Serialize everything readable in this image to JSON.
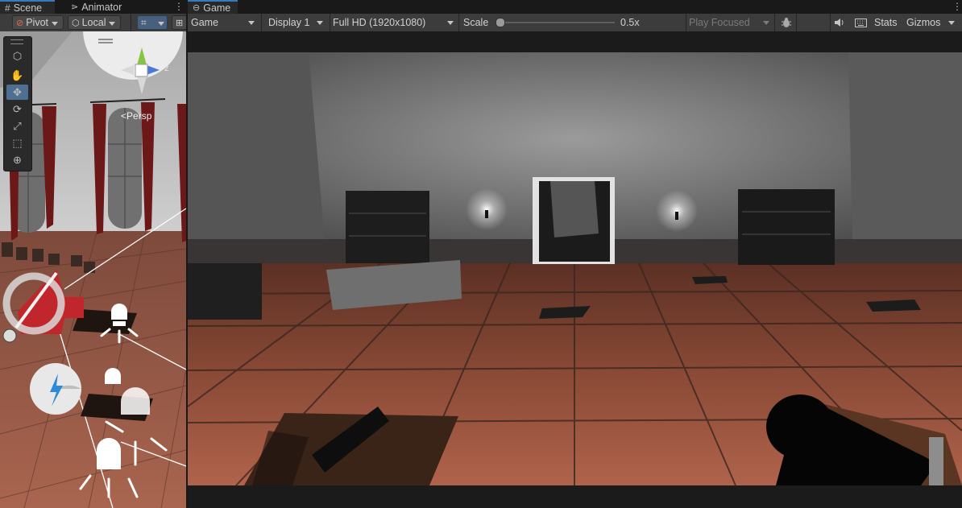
{
  "scene_panel": {
    "tabs": [
      {
        "label": "Scene",
        "icon": "hash-icon"
      },
      {
        "label": "Animator",
        "icon": "animator-icon"
      }
    ],
    "toolbar": {
      "pivot": "Pivot",
      "local": "Local"
    },
    "gizmo": {
      "y_label": "y",
      "z_label": "z",
      "projection": "Persp"
    },
    "tools": [
      "view-tool",
      "hand-tool",
      "move-tool",
      "rotate-tool",
      "scale-tool",
      "rect-tool",
      "transform-tool"
    ]
  },
  "game_panel": {
    "tab": {
      "label": "Game",
      "icon": "gamepad-icon"
    },
    "toolbar": {
      "view_mode": "Game",
      "display": "Display 1",
      "resolution": "Full HD (1920x1080)",
      "scale_label": "Scale",
      "scale_value": "0.5x",
      "play_mode": "Play Focused",
      "stats": "Stats",
      "gizmos": "Gizmos"
    }
  },
  "colors": {
    "accent": "#3a79bb",
    "selected_tool": "#4f6f92",
    "camera_red": "#c0262b"
  }
}
